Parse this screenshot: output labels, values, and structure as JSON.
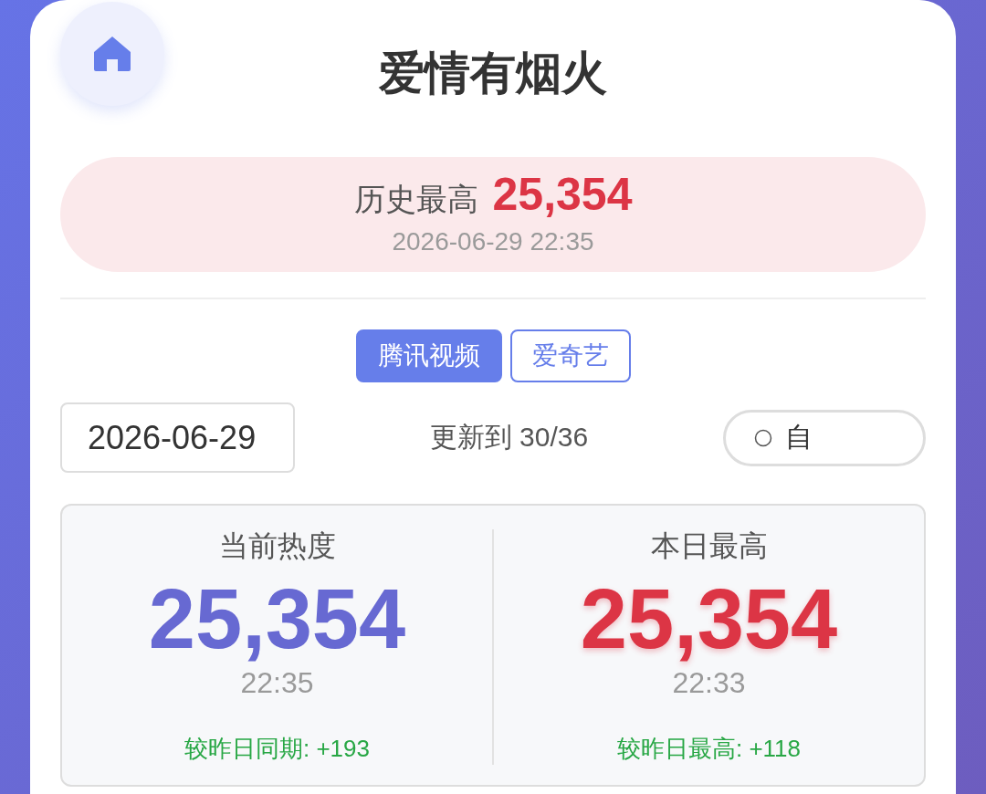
{
  "title": "爱情有烟火",
  "record_banner": {
    "label": "历史最高",
    "value": "25,354",
    "time": "2026-06-29 22:35"
  },
  "platform_tabs": [
    {
      "label": "腾讯视频",
      "selected": true
    },
    {
      "label": "爱奇艺",
      "selected": false
    }
  ],
  "date_field": {
    "value": "2026-06-29"
  },
  "update_status": "更新到 30/36",
  "auto_toggle": {
    "label": "自",
    "checked": false
  },
  "stats": [
    {
      "kind": "current",
      "label": "当前热度",
      "value": "25,354",
      "time": "22:35",
      "comparison": "较昨日同期: +193"
    },
    {
      "kind": "peak",
      "label": "本日最高",
      "value": "25,354",
      "time": "22:33",
      "comparison": "较昨日最高: +118"
    }
  ]
}
